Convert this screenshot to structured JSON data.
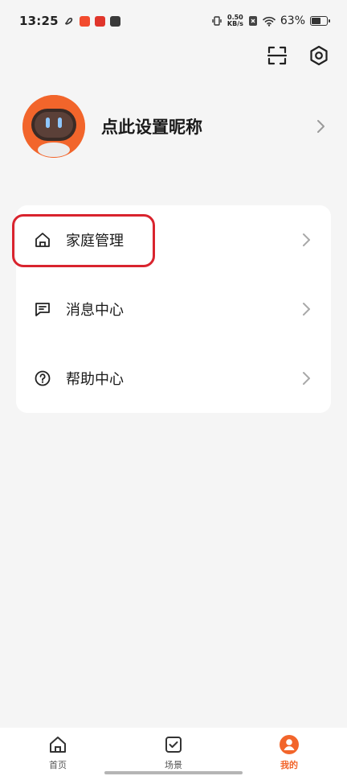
{
  "status_bar": {
    "time": "13:25",
    "net_speed_value": "0.50",
    "net_speed_unit": "KB/s",
    "battery_percent": "63%",
    "battery_level": 0.63
  },
  "top_actions": [
    {
      "icon": "scan-icon"
    },
    {
      "icon": "settings-icon"
    }
  ],
  "profile": {
    "nickname": "点此设置昵称",
    "avatar": "robot-avatar"
  },
  "menu": [
    {
      "label": "家庭管理",
      "icon": "home-icon",
      "highlighted": true
    },
    {
      "label": "消息中心",
      "icon": "message-icon",
      "highlighted": false
    },
    {
      "label": "帮助中心",
      "icon": "help-icon",
      "highlighted": false
    }
  ],
  "bottom_nav": [
    {
      "label": "首页",
      "icon": "home-tab-icon",
      "active": false
    },
    {
      "label": "场景",
      "icon": "scene-tab-icon",
      "active": false
    },
    {
      "label": "我的",
      "icon": "profile-tab-icon",
      "active": true
    }
  ],
  "colors": {
    "accent": "#f2652b",
    "highlight": "#d9242e",
    "background": "#f5f5f5"
  }
}
